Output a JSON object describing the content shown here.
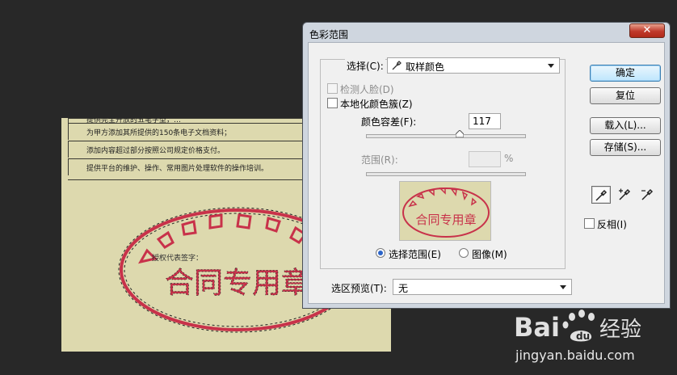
{
  "document": {
    "rows": [
      "提供完全开放的五笔字型，…",
      "为甲方添加其所提供的150条电子文档资料；",
      "添加内容超过部分按照公司规定价格支付。",
      "提供平台的维护、操作、常用图片处理软件的操作培训。"
    ],
    "signature_label": "授权代表签字：",
    "stamp_text": "合同专用章",
    "stamp_ring_text": "…技术有限公司"
  },
  "dialog": {
    "title": "色彩范围",
    "close_symbol": "✕",
    "select": {
      "label": "选择(C):",
      "value": "取样颜色"
    },
    "detect_faces": {
      "label": "检测人脸(D)",
      "checked": false,
      "enabled": false
    },
    "localized_clusters": {
      "label": "本地化颜色簇(Z)",
      "checked": false
    },
    "fuzziness": {
      "label": "颜色容差(F):",
      "value": "117",
      "slider_fraction": 0.585
    },
    "range": {
      "label": "范围(R):",
      "value": "",
      "unit": "%"
    },
    "view_options": [
      {
        "label": "选择范围(E)",
        "selected": true
      },
      {
        "label": "图像(M)",
        "selected": false
      }
    ],
    "selection_preview": {
      "label": "选区预览(T):",
      "value": "无"
    },
    "buttons": {
      "ok": "确定",
      "reset": "复位",
      "load": "载入(L)...",
      "save": "存储(S)..."
    },
    "eyedroppers": [
      "eyedropper-icon",
      "eyedropper-plus-icon",
      "eyedropper-minus-icon"
    ],
    "invert": {
      "label": "反相(I)",
      "checked": false
    }
  },
  "watermark": {
    "brand": "Bai 经验",
    "url": "jingyan.baidu.com"
  },
  "colors": {
    "background": "#282828",
    "paper": "#ddd9ae",
    "stamp": "#c8324a",
    "accent_radio": "#2a63c8",
    "close_button": "#c0392b"
  }
}
